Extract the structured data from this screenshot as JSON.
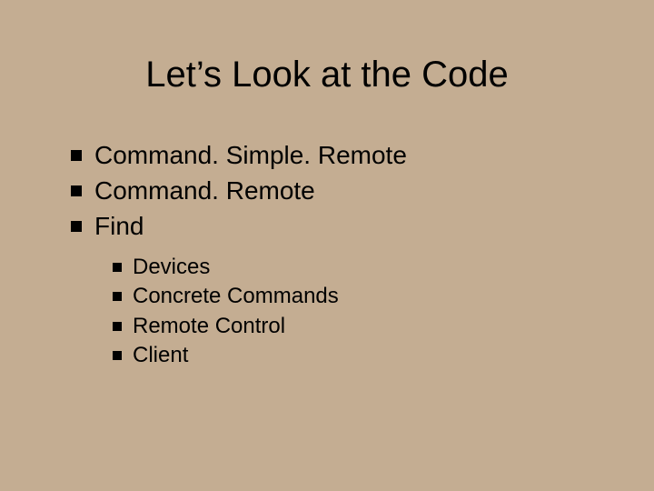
{
  "slide": {
    "title": "Let’s Look at the Code",
    "bullets": [
      {
        "label": "Command. Simple. Remote"
      },
      {
        "label": "Command. Remote"
      },
      {
        "label": "Find"
      }
    ],
    "sub_bullets": [
      {
        "label": "Devices"
      },
      {
        "label": "Concrete Commands"
      },
      {
        "label": "Remote Control"
      },
      {
        "label": "Client"
      }
    ]
  }
}
